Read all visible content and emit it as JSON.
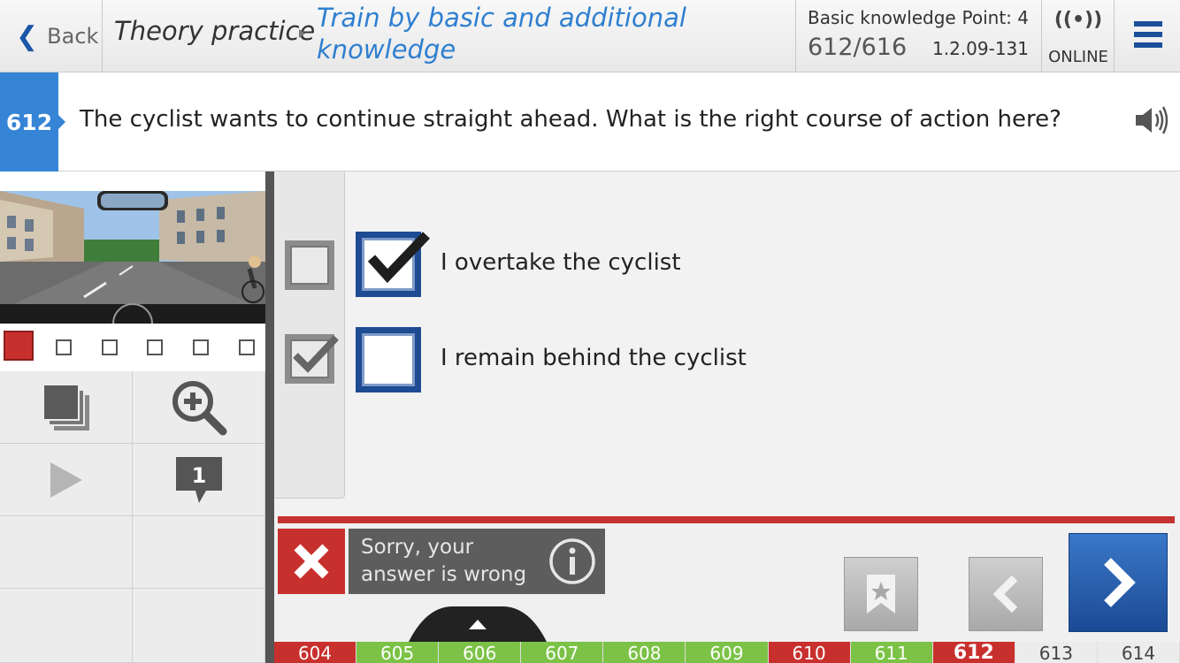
{
  "header": {
    "back_label": "Back",
    "section": "Theory practice",
    "mode": "Train by basic and additional knowledge",
    "category": "Basic knowledge",
    "points": "Point: 4",
    "progress": "612/616",
    "question_code": "1.2.09-131",
    "status": "ONLINE"
  },
  "question": {
    "number": "612",
    "text": "The cyclist wants to continue straight ahead. What is the right course of action here?"
  },
  "answers": [
    {
      "text": "I overtake the cyclist",
      "user_checked": true,
      "correct_checked": false
    },
    {
      "text": "I remain behind the cyclist",
      "user_checked": false,
      "correct_checked": true
    }
  ],
  "result": {
    "message": "Sorry, your answer is wrong"
  },
  "tools": {
    "comment_count": "1"
  },
  "strip": [
    {
      "num": "604",
      "state": "red"
    },
    {
      "num": "605",
      "state": "green"
    },
    {
      "num": "606",
      "state": "green"
    },
    {
      "num": "607",
      "state": "green"
    },
    {
      "num": "608",
      "state": "green"
    },
    {
      "num": "609",
      "state": "green"
    },
    {
      "num": "610",
      "state": "red"
    },
    {
      "num": "611",
      "state": "green"
    },
    {
      "num": "612",
      "state": "cur"
    },
    {
      "num": "613",
      "state": "none"
    },
    {
      "num": "614",
      "state": "none"
    }
  ],
  "colors": {
    "accent_blue": "#3584d6",
    "wrong_red": "#c8302e",
    "correct_green": "#7bc246",
    "dark_blue": "#1e4b92"
  },
  "icons": [
    "back-chevron-icon",
    "signal-icon",
    "menu-icon",
    "speaker-icon",
    "layers-icon",
    "zoom-in-icon",
    "play-icon",
    "comment-icon",
    "close-icon",
    "info-icon",
    "bookmark-icon",
    "chevron-left-icon",
    "chevron-right-icon",
    "chevron-up-icon"
  ]
}
